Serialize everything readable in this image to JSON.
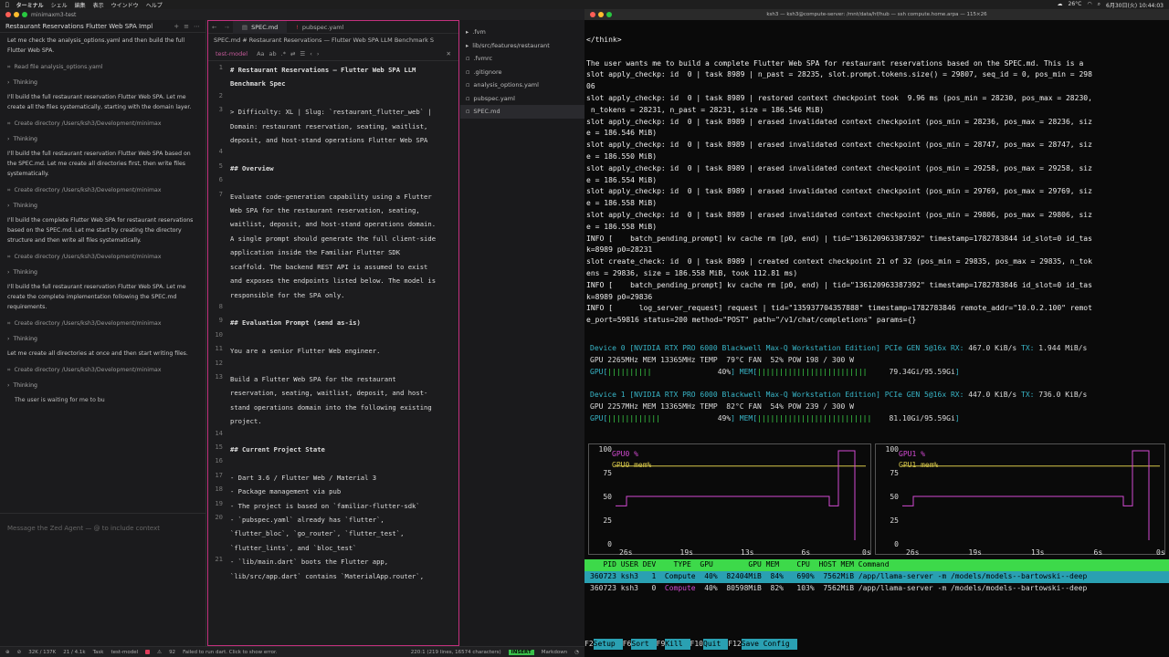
{
  "menubar": {
    "app": "ターミナル",
    "items": [
      "シェル",
      "編集",
      "表示",
      "ウインドウ",
      "ヘルプ"
    ],
    "temp": "26°C",
    "datetime": "6月30日(火) 10:44:03"
  },
  "zed": {
    "window_title": "minimaxm3-test",
    "agent": {
      "thread_title": "Restaurant Reservations Flutter Web SPA Impl",
      "feed": [
        {
          "type": "msg",
          "text": "Let me check the analysis_options.yaml and then build the full Flutter Web SPA."
        },
        {
          "type": "tool",
          "text": "Read file analysis_options.yaml"
        },
        {
          "type": "thinking",
          "text": "Thinking"
        },
        {
          "type": "msg",
          "text": "I'll build the full restaurant reservation Flutter Web SPA. Let me create all the files systematically, starting with the domain layer."
        },
        {
          "type": "tool",
          "text": "Create directory /Users/ksh3/Development/minimax"
        },
        {
          "type": "thinking",
          "text": "Thinking"
        },
        {
          "type": "msg",
          "text": "I'll build the full restaurant reservation Flutter Web SPA based on the SPEC.md. Let me create all directories first, then write files systematically."
        },
        {
          "type": "tool",
          "text": "Create directory /Users/ksh3/Development/minimax"
        },
        {
          "type": "thinking",
          "text": "Thinking"
        },
        {
          "type": "msg",
          "text": "I'll build the complete Flutter Web SPA for restaurant reservations based on the SPEC.md. Let me start by creating the directory structure and then write all files systematically."
        },
        {
          "type": "tool",
          "text": "Create directory /Users/ksh3/Development/minimax"
        },
        {
          "type": "thinking",
          "text": "Thinking"
        },
        {
          "type": "msg",
          "text": "I'll build the full restaurant reservation Flutter Web SPA. Let me create the complete implementation following the SPEC.md requirements."
        },
        {
          "type": "tool",
          "text": "Create directory /Users/ksh3/Development/minimax"
        },
        {
          "type": "thinking",
          "text": "Thinking"
        },
        {
          "type": "msg",
          "text": "Let me create all directories at once and then start writing files."
        },
        {
          "type": "tool",
          "text": "Create directory /Users/ksh3/Development/minimax"
        },
        {
          "type": "thinking",
          "text": "Thinking"
        },
        {
          "type": "thinking_text",
          "text": "The user is waiting for me to bu"
        }
      ],
      "input_placeholder": "Message the Zed Agent — @ to include context"
    },
    "editor": {
      "tabs": [
        "SPEC.md",
        "pubspec.yaml"
      ],
      "breadcrumb": "SPEC.md  #  Restaurant Reservations — Flutter Web SPA LLM Benchmark S",
      "search_value": "test-model",
      "lines": [
        {
          "n": "1",
          "t": "# Restaurant Reservations — Flutter Web SPA LLM Benchmark Spec",
          "h": true
        },
        {
          "n": "2",
          "t": ""
        },
        {
          "n": "3",
          "t": "> Difficulty: XL | Slug: `restaurant_flutter_web` | Domain: restaurant reservation, seating, waitlist, deposit, and host-stand operations Flutter Web SPA"
        },
        {
          "n": "4",
          "t": ""
        },
        {
          "n": "5",
          "t": "## Overview",
          "h": true
        },
        {
          "n": "6",
          "t": ""
        },
        {
          "n": "7",
          "t": "Evaluate code-generation capability using a Flutter Web SPA for the restaurant reservation, seating, waitlist, deposit, and host-stand operations domain. A single prompt should generate the full client-side application inside the Familiar Flutter SDK scaffold. The backend REST API is assumed to exist and exposes the endpoints listed below. The model is responsible for the SPA only."
        },
        {
          "n": "8",
          "t": ""
        },
        {
          "n": "9",
          "t": "## Evaluation Prompt (send as-is)",
          "h": true
        },
        {
          "n": "10",
          "t": ""
        },
        {
          "n": "11",
          "t": "You are a senior Flutter Web engineer."
        },
        {
          "n": "12",
          "t": ""
        },
        {
          "n": "13",
          "t": "Build a Flutter Web SPA for the restaurant reservation, seating, waitlist, deposit, and host-stand operations domain into the following existing project."
        },
        {
          "n": "14",
          "t": ""
        },
        {
          "n": "15",
          "t": "## Current Project State",
          "h": true
        },
        {
          "n": "16",
          "t": ""
        },
        {
          "n": "17",
          "t": "- Dart 3.6 / Flutter Web / Material 3"
        },
        {
          "n": "18",
          "t": "- Package management via pub"
        },
        {
          "n": "19",
          "t": "- The project is based on `familiar-flutter-sdk`"
        },
        {
          "n": "20",
          "t": "- `pubspec.yaml` already has `flutter`, `flutter_bloc`, `go_router`, `flutter_test`, `flutter_lints`, and `bloc_test`"
        },
        {
          "n": "21",
          "t": "- `lib/main.dart` boots the Flutter app, `lib/src/app.dart` contains `MaterialApp.router`,"
        }
      ]
    },
    "tree": {
      "items": [
        ".fvm",
        "lib/src/features/restaurant",
        ".fvmrc",
        ".gitignore",
        "analysis_options.yaml",
        "pubspec.yaml",
        "SPEC.md"
      ],
      "selected": "SPEC.md"
    },
    "status": {
      "errors": "32K / 137K",
      "tokens": "21 / 4.1k",
      "mode": "Task",
      "model": "test-model",
      "warnings": "92",
      "message": "Failed to run dart. Click to show error.",
      "cursor": "220:1 (219 lines, 16574 characters)",
      "vim_mode": "INSERT",
      "language": "Markdown"
    }
  },
  "terminal": {
    "title": "ksh3 — ksh3@compute-server: /mnt/data/hf/hub — ssh compute.home.arpa — 115×26",
    "log_lines": [
      "</think>",
      "",
      "The user wants me to build a complete Flutter Web SPA for restaurant reservations based on the SPEC.md. This is a",
      "slot apply_checkp: id  0 | task 8989 | n_past = 28235, slot.prompt.tokens.size() = 29807, seq_id = 0, pos_min = 298",
      "06",
      "slot apply_checkp: id  0 | task 8989 | restored context checkpoint took  9.96 ms (pos_min = 28230, pos_max = 28230,",
      " n_tokens = 28231, n_past = 28231, size = 186.546 MiB)",
      "slot apply_checkp: id  0 | task 8989 | erased invalidated context checkpoint (pos_min = 28236, pos_max = 28236, siz",
      "e = 186.546 MiB)",
      "slot apply_checkp: id  0 | task 8989 | erased invalidated context checkpoint (pos_min = 28747, pos_max = 28747, siz",
      "e = 186.550 MiB)",
      "slot apply_checkp: id  0 | task 8989 | erased invalidated context checkpoint (pos_min = 29258, pos_max = 29258, siz",
      "e = 186.554 MiB)",
      "slot apply_checkp: id  0 | task 8989 | erased invalidated context checkpoint (pos_min = 29769, pos_max = 29769, siz",
      "e = 186.558 MiB)",
      "slot apply_checkp: id  0 | task 8989 | erased invalidated context checkpoint (pos_min = 29806, pos_max = 29806, siz",
      "e = 186.558 MiB)",
      "INFO [    batch_pending_prompt] kv cache rm [p0, end) | tid=\"136120963387392\" timestamp=1782783844 id_slot=0 id_tas",
      "k=8989 p0=28231",
      "slot create_check: id  0 | task 8989 | created context checkpoint 21 of 32 (pos_min = 29835, pos_max = 29835, n_tok",
      "ens = 29836, size = 186.558 MiB, took 112.81 ms)",
      "INFO [    batch_pending_prompt] kv cache rm [p0, end) | tid=\"136120963387392\" timestamp=1782783846 id_slot=0 id_tas",
      "k=8989 p0=29836",
      "INFO [      log_server_request] request | tid=\"135937704357888\" timestamp=1782783846 remote_addr=\"10.0.2.100\" remot",
      "e_port=59816 status=200 method=\"POST\" path=\"/v1/chat/completions\" params={}"
    ],
    "nvtop": {
      "devices": [
        {
          "line1_prefix": "Device 0 [NVIDIA RTX PRO 6000 Blackwell Max-Q Workstation Edition] PCIe GEN 5@16x RX: ",
          "rx": "467.0 KiB/s",
          "tx": "1.944 MiB/s",
          "line2": "GPU 2265MHz MEM 13365MHz TEMP  79°C FAN  52% POW 198 / 300 W",
          "gpu_pct": "40%",
          "mem": "79.34Gi/95.59Gi",
          "gpu_util": 0.4,
          "mem_util": 0.83
        },
        {
          "line1_prefix": "Device 1 [NVIDIA RTX PRO 6000 Blackwell Max-Q Workstation Edition] PCIe GEN 5@16x RX: ",
          "rx": "447.0 KiB/s",
          "tx": "736.0 KiB/s",
          "line2": "GPU 2257MHz MEM 13365MHz TEMP  82°C FAN  54% POW 239 / 300 W",
          "gpu_pct": "49%",
          "mem": "81.10Gi/95.59Gi",
          "gpu_util": 0.49,
          "mem_util": 0.85
        }
      ],
      "charts": [
        {
          "legend": [
            "GPU0 %",
            "GPU0 mem%"
          ]
        },
        {
          "legend": [
            "GPU1 %",
            "GPU1 mem%"
          ]
        }
      ],
      "y_ticks": [
        "100",
        "75",
        "50",
        "25",
        "0"
      ],
      "x_ticks": [
        "26s",
        "19s",
        "13s",
        "6s",
        "0s"
      ],
      "proc_header": "   PID USER DEV    TYPE  GPU        GPU MEM    CPU  HOST MEM Command",
      "processes": [
        {
          "pid": "360723",
          "user": "ksh3",
          "dev": "1",
          "type": "Compute",
          "gpu": "40%",
          "gpumem": "82404MiB",
          "memp": "84%",
          "cpu": "690%",
          "hostmem": "7562MiB",
          "cmd": "/app/llama-server -m /models/models--bartowski--deep"
        },
        {
          "pid": "360723",
          "user": "ksh3",
          "dev": "0",
          "type": "Compute",
          "gpu": "40%",
          "gpumem": "80598MiB",
          "memp": "82%",
          "cpu": "103%",
          "hostmem": "7562MiB",
          "cmd": "/app/llama-server -m /models/models--bartowski--deep"
        }
      ],
      "fkeys": [
        {
          "k": "F2",
          "v": "Setup"
        },
        {
          "k": "F6",
          "v": "Sort"
        },
        {
          "k": "F9",
          "v": "Kill"
        },
        {
          "k": "F10",
          "v": "Quit"
        },
        {
          "k": "F12",
          "v": "Save Config"
        }
      ]
    }
  }
}
